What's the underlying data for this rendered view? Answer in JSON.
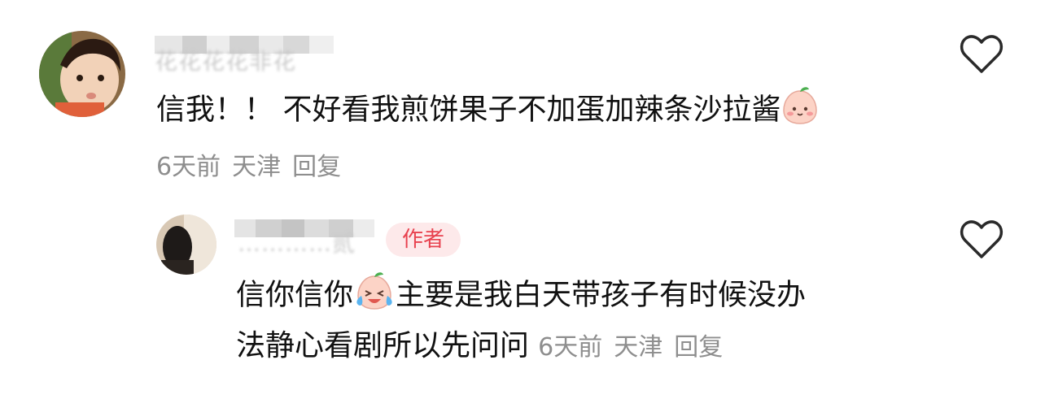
{
  "comment1": {
    "username": "花花花花非花",
    "text": "信我！！ 不好看我煎饼果子不加蛋加辣条沙拉酱",
    "emoji": "blush-face-emoji",
    "time": "6天前",
    "location": "天津",
    "reply_label": "回复"
  },
  "comment2": {
    "username": "…………贰",
    "author_badge": "作者",
    "text_line1_a": "信你信你",
    "text_line1_b": "主要是我白天带孩子有时候没办",
    "text_line2": "法静心看剧所以先问问",
    "emoji": "laugh-cry-emoji",
    "time": "6天前",
    "location": "天津",
    "reply_label": "回复"
  },
  "colors": {
    "meta": "#8e8e8e",
    "badge_text": "#e8424f",
    "badge_bg": "#fde9ea"
  }
}
